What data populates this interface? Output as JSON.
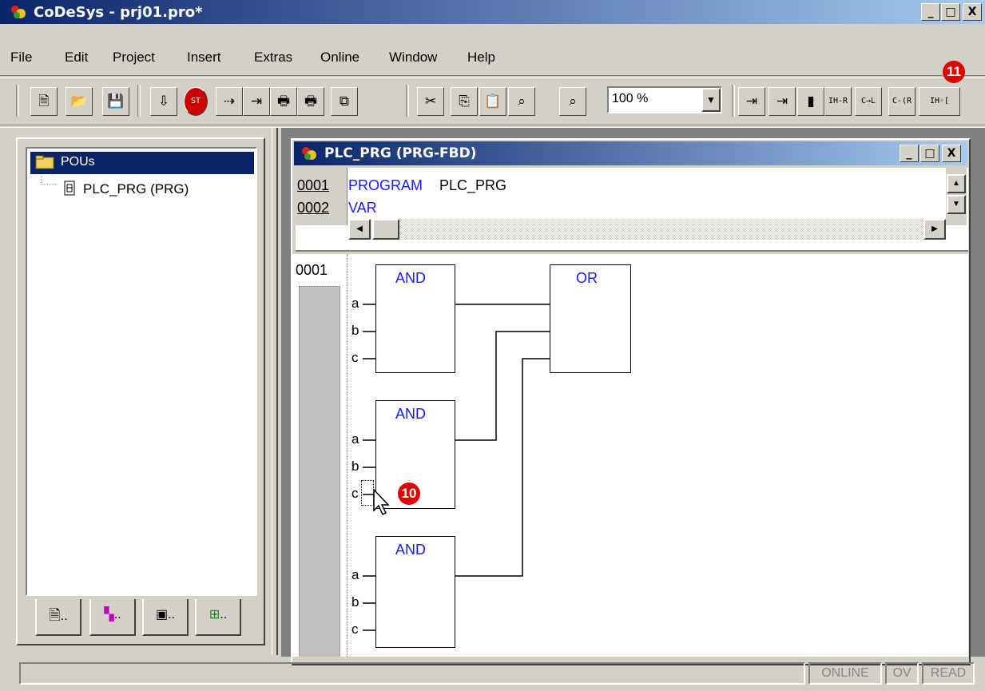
{
  "app": {
    "title": "CoDeSys - prj01.pro*",
    "min_glyph": "_",
    "max_glyph": "□",
    "close_glyph": "X"
  },
  "menu": [
    "File",
    "Edit",
    "Project",
    "Insert",
    "Extras",
    "Online",
    "Window",
    "Help"
  ],
  "toolbar": {
    "zoom_value": "100 %",
    "zoom_arrow": "▼",
    "glyphs": [
      "🗎",
      "📂",
      "💾",
      "⇩",
      "ST",
      "⇢",
      "⇥",
      "🖶",
      "🖶",
      "⧉",
      "✂",
      "⎘",
      "📋",
      "⌕",
      "⌕",
      "⇥",
      "⇥",
      "▮",
      "IH-R",
      "C→L",
      "C-(R",
      "IH◦["
    ]
  },
  "annotations": {
    "marker_10": "10",
    "marker_11": "11"
  },
  "pou_tree": {
    "root_label": "POUs",
    "items": [
      {
        "label": "PLC_PRG (PRG)"
      }
    ]
  },
  "bottom_tabs": [
    "..",
    "..",
    "..",
    ".."
  ],
  "child_window": {
    "title": "PLC_PRG (PRG-FBD)",
    "declarations": [
      {
        "line": "0001",
        "keyword": "PROGRAM",
        "rest": " PLC_PRG"
      },
      {
        "line": "0002",
        "keyword": "VAR",
        "rest": ""
      }
    ],
    "network_number": "0001",
    "blocks": [
      {
        "name": "AND",
        "pins": [
          "a",
          "b",
          "c"
        ]
      },
      {
        "name": "AND",
        "pins": [
          "a",
          "b",
          "c"
        ]
      },
      {
        "name": "AND",
        "pins": [
          "a",
          "b",
          "c"
        ]
      },
      {
        "name": "OR"
      }
    ]
  },
  "status_bar": {
    "online": "ONLINE",
    "ov": "OV",
    "read": "READ"
  },
  "colors": {
    "title_start": "#0a246a",
    "title_end": "#a6caf0",
    "keyword_blue": "#1a1aff",
    "badge_red": "#e00000",
    "selection": "#0a246a"
  }
}
